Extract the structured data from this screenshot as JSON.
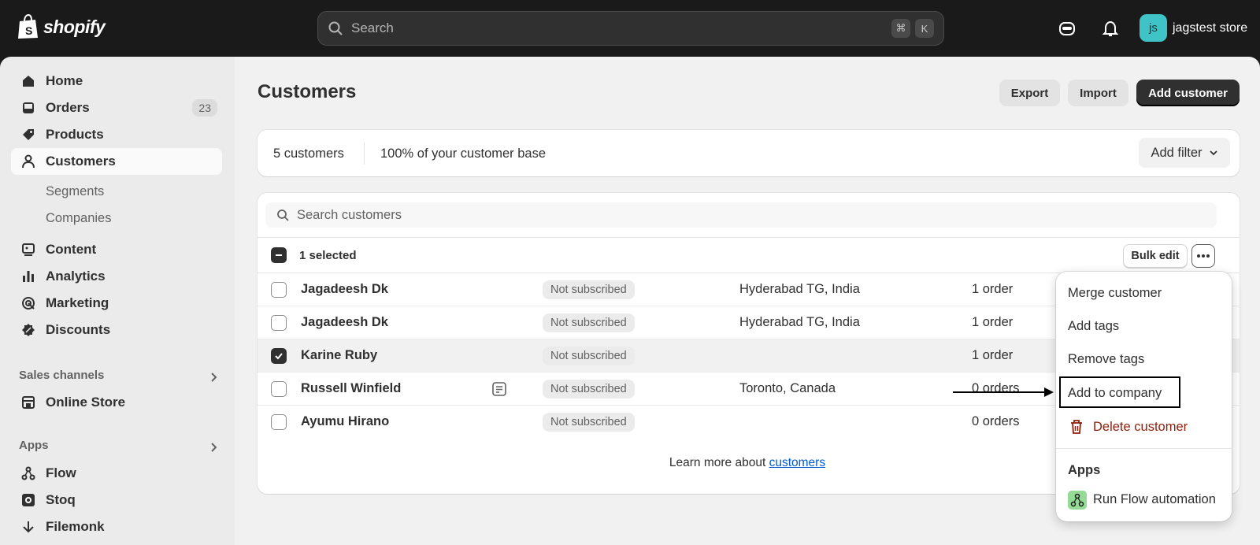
{
  "topbar": {
    "logo_text": "shopify",
    "search_placeholder": "Search",
    "shortcut_keys": [
      "⌘",
      "K"
    ],
    "store_initials": "js",
    "store_name": "jagstest store"
  },
  "sidebar": {
    "items": [
      {
        "label": "Home",
        "icon": "home-icon"
      },
      {
        "label": "Orders",
        "icon": "inbox-icon",
        "badge": "23"
      },
      {
        "label": "Products",
        "icon": "tag-icon"
      },
      {
        "label": "Customers",
        "icon": "person-icon",
        "active": true
      }
    ],
    "customer_subitems": [
      "Segments",
      "Companies"
    ],
    "items2": [
      {
        "label": "Content",
        "icon": "content-icon"
      },
      {
        "label": "Analytics",
        "icon": "bar-chart-icon"
      },
      {
        "label": "Marketing",
        "icon": "target-icon"
      },
      {
        "label": "Discounts",
        "icon": "discount-icon"
      }
    ],
    "sales_channels_title": "Sales channels",
    "online_store": "Online Store",
    "apps_title": "Apps",
    "apps": [
      "Flow",
      "Stoq",
      "Filemonk"
    ]
  },
  "page": {
    "title": "Customers",
    "export_label": "Export",
    "import_label": "Import",
    "add_customer_label": "Add customer"
  },
  "summary": {
    "count": "5 customers",
    "base": "100% of your customer base",
    "filter_label": "Add filter"
  },
  "table": {
    "search_placeholder": "Search customers",
    "selected_text": "1 selected",
    "bulk_edit_label": "Bulk edit",
    "rows": [
      {
        "name": "Jagadeesh Dk",
        "subscription": "Not subscribed",
        "location": "Hyderabad TG, India",
        "orders": "1 order",
        "checked": false
      },
      {
        "name": "Jagadeesh Dk",
        "subscription": "Not subscribed",
        "location": "Hyderabad TG, India",
        "orders": "1 order",
        "checked": false
      },
      {
        "name": "Karine Ruby",
        "subscription": "Not subscribed",
        "location": "",
        "orders": "1 order",
        "checked": true
      },
      {
        "name": "Russell Winfield",
        "subscription": "Not subscribed",
        "location": "Toronto, Canada",
        "orders": "0 orders",
        "checked": false,
        "has_note": true
      },
      {
        "name": "Ayumu Hirano",
        "subscription": "Not subscribed",
        "location": "",
        "orders": "0 orders",
        "checked": false
      }
    ]
  },
  "footer": {
    "learn_prefix": "Learn more about ",
    "learn_link": "customers"
  },
  "menu": {
    "items": [
      "Merge customer",
      "Add tags",
      "Remove tags",
      "Add to company"
    ],
    "delete_label": "Delete customer",
    "apps_heading": "Apps",
    "run_flow_label": "Run Flow automation"
  },
  "colors": {
    "topbar": "#1a1a1a",
    "avatar": "#3fc3c6",
    "link": "#005bd3",
    "danger": "#8e1f0b"
  }
}
